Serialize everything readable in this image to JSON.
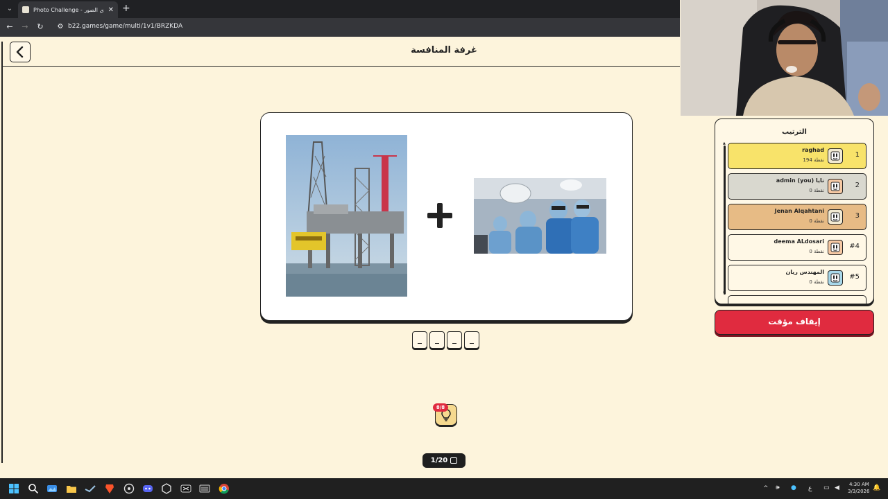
{
  "browser": {
    "tab_title": "Photo Challenge - تحدي الصور",
    "url": "b22.games/game/multi/1v1/BRZKDA"
  },
  "header": {
    "title": "غرفة المنافسة"
  },
  "puzzle": {
    "images": [
      "oil-rig-photo",
      "surgeons-photo"
    ],
    "operator_icon": "plus-icon",
    "slots": [
      "_",
      "_",
      "_",
      "_"
    ]
  },
  "hint": {
    "badge": "8/8",
    "icon": "lightbulb-icon"
  },
  "progress": {
    "label": "1/20"
  },
  "leaderboard": {
    "title": "الترتيب",
    "players": [
      {
        "rank": "1",
        "name": "raghad",
        "you": "",
        "points": "194 نقطة",
        "color": "#f8e36a"
      },
      {
        "rank": "2",
        "name": "admin (you) نايا",
        "you": "(you)",
        "points": "0 نقطة",
        "color": "#d9d8cf"
      },
      {
        "rank": "3",
        "name": "Jenan Alqahtani",
        "you": "",
        "points": "0 نقطة",
        "color": "#e7bb85"
      },
      {
        "rank": "#4",
        "name": "deema ALdosari",
        "you": "",
        "points": "0 نقطة",
        "color": "#fff8e6"
      },
      {
        "rank": "#5",
        "name": "المهندس ريان",
        "you": "",
        "points": "0 نقطة",
        "color": "#fff8e6"
      }
    ]
  },
  "pause_button": {
    "label": "إيقاف مؤقت"
  },
  "taskbar": {
    "time": "4:30 AM",
    "date": "3/3/2026",
    "lang": "ع"
  }
}
